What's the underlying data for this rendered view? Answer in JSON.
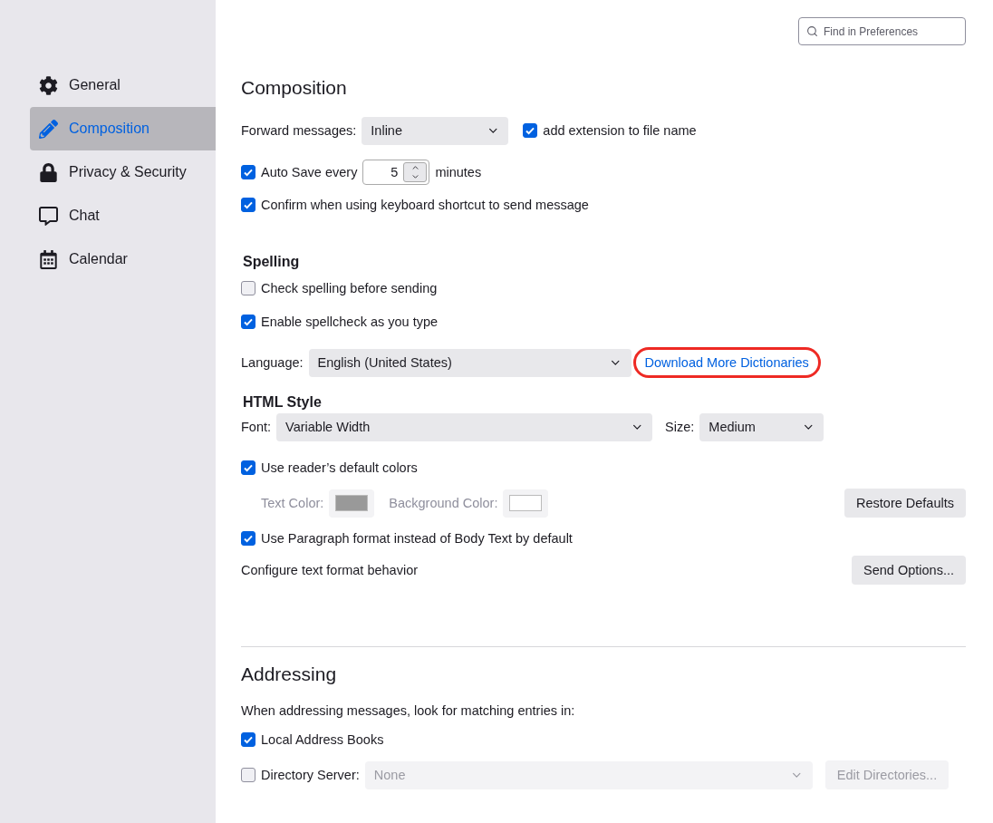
{
  "search": {
    "placeholder": "Find in Preferences"
  },
  "sidebar": {
    "items": [
      {
        "label": "General",
        "selected": false
      },
      {
        "label": "Composition",
        "selected": true
      },
      {
        "label": "Privacy & Security",
        "selected": false
      },
      {
        "label": "Chat",
        "selected": false
      },
      {
        "label": "Calendar",
        "selected": false
      }
    ]
  },
  "composition": {
    "title": "Composition",
    "forward": {
      "label": "Forward messages:",
      "value": "Inline"
    },
    "add_extension": {
      "label": "add extension to file name",
      "checked": true
    },
    "auto_save": {
      "label": "Auto Save every",
      "checked": true,
      "value": "5",
      "unit": "minutes"
    },
    "confirm": {
      "label": "Confirm when using keyboard shortcut to send message",
      "checked": true
    }
  },
  "spelling": {
    "title": "Spelling",
    "check_before": {
      "label": "Check spelling before sending",
      "checked": false
    },
    "spellcheck": {
      "label": "Enable spellcheck as you type",
      "checked": true
    },
    "language": {
      "label": "Language:",
      "value": "English (United States)"
    },
    "download_link": {
      "label": "Download More Dictionaries",
      "highlighted": true
    }
  },
  "html_style": {
    "title": "HTML Style",
    "font": {
      "label": "Font:",
      "value": "Variable Width"
    },
    "size": {
      "label": "Size:",
      "value": "Medium"
    },
    "reader_colors": {
      "label": "Use reader’s default colors",
      "checked": true
    },
    "colors": {
      "disabled": true,
      "items": [
        {
          "label": "Text Color:",
          "color": "#999999"
        },
        {
          "label": "Background Color:",
          "color": "#ffffff"
        }
      ]
    },
    "restore_button": "Restore Defaults",
    "paragraph": {
      "label": "Use Paragraph format instead of Body Text by default",
      "checked": true
    },
    "configure": {
      "label": "Configure text format behavior",
      "button": "Send Options..."
    }
  },
  "addressing": {
    "title": "Addressing",
    "description": "When addressing messages, look for matching entries in:",
    "local": {
      "label": "Local Address Books",
      "checked": true
    },
    "directory": {
      "label": "Directory Server:",
      "checked": false,
      "value": "None",
      "disabled": true
    },
    "edit_button": {
      "label": "Edit Directories...",
      "disabled": true
    }
  }
}
